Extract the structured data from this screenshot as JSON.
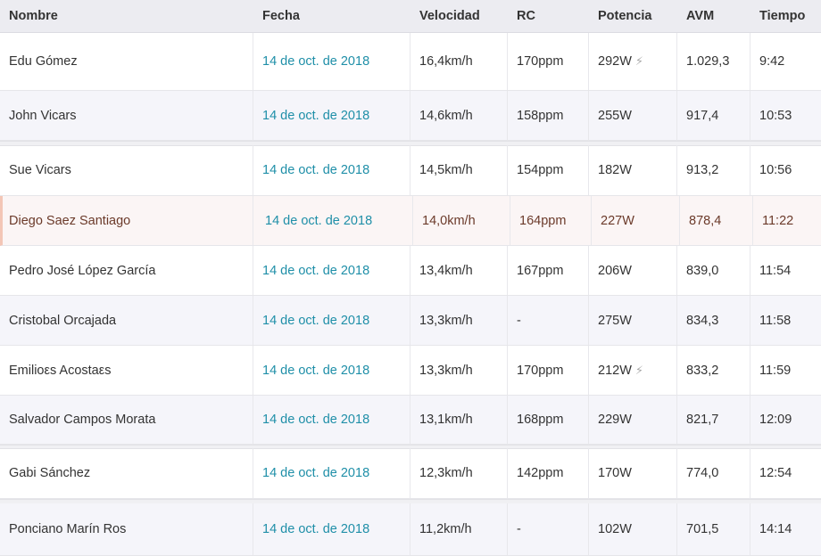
{
  "headers": {
    "nombre": "Nombre",
    "fecha": "Fecha",
    "velocidad": "Velocidad",
    "rc": "RC",
    "potencia": "Potencia",
    "avm": "AVM",
    "tiempo": "Tiempo"
  },
  "rows": [
    {
      "nombre": "Edu Gómez",
      "fecha": "14 de oct. de 2018",
      "velocidad": "16,4km/h",
      "rc": "170ppm",
      "potencia": "292W",
      "power_icon": "bolt-icon",
      "avm": "1.029,3",
      "tiempo": "9:42"
    },
    {
      "nombre": "John Vicars",
      "fecha": "14 de oct. de 2018",
      "velocidad": "14,6km/h",
      "rc": "158ppm",
      "potencia": "255W",
      "avm": "917,4",
      "tiempo": "10:53"
    },
    {
      "nombre": "Sue Vicars",
      "fecha": "14 de oct. de 2018",
      "velocidad": "14,5km/h",
      "rc": "154ppm",
      "potencia": "182W",
      "avm": "913,2",
      "tiempo": "10:56"
    },
    {
      "nombre": "Diego Saez Santiago",
      "fecha": "14 de oct. de 2018",
      "velocidad": "14,0km/h",
      "rc": "164ppm",
      "potencia": "227W",
      "avm": "878,4",
      "tiempo": "11:22"
    },
    {
      "nombre": "Pedro José López García",
      "fecha": "14 de oct. de 2018",
      "velocidad": "13,4km/h",
      "rc": "167ppm",
      "potencia": "206W",
      "avm": "839,0",
      "tiempo": "11:54"
    },
    {
      "nombre": "Cristobal Orcajada",
      "fecha": "14 de oct. de 2018",
      "velocidad": "13,3km/h",
      "rc": "-",
      "potencia": "275W",
      "avm": "834,3",
      "tiempo": "11:58"
    },
    {
      "nombre": "Emilioεs Acostaεs",
      "fecha": "14 de oct. de 2018",
      "velocidad": "13,3km/h",
      "rc": "170ppm",
      "potencia": "212W",
      "power_icon": "bolt-icon",
      "avm": "833,2",
      "tiempo": "11:59"
    },
    {
      "nombre": "Salvador Campos Morata",
      "fecha": "14 de oct. de 2018",
      "velocidad": "13,1km/h",
      "rc": "168ppm",
      "potencia": "229W",
      "avm": "821,7",
      "tiempo": "12:09"
    },
    {
      "nombre": "Gabi Sánchez",
      "fecha": "14 de oct. de 2018",
      "velocidad": "12,3km/h",
      "rc": "142ppm",
      "potencia": "170W",
      "avm": "774,0",
      "tiempo": "12:54"
    },
    {
      "nombre": "Ponciano Marín Ros",
      "fecha": "14 de oct. de 2018",
      "velocidad": "11,2km/h",
      "rc": "-",
      "potencia": "102W",
      "avm": "701,5",
      "tiempo": "14:14"
    }
  ],
  "colors": {
    "date_link": "#1f8fa8",
    "header_bg": "#ececf1",
    "highlight_border": "#f3c6b6"
  }
}
